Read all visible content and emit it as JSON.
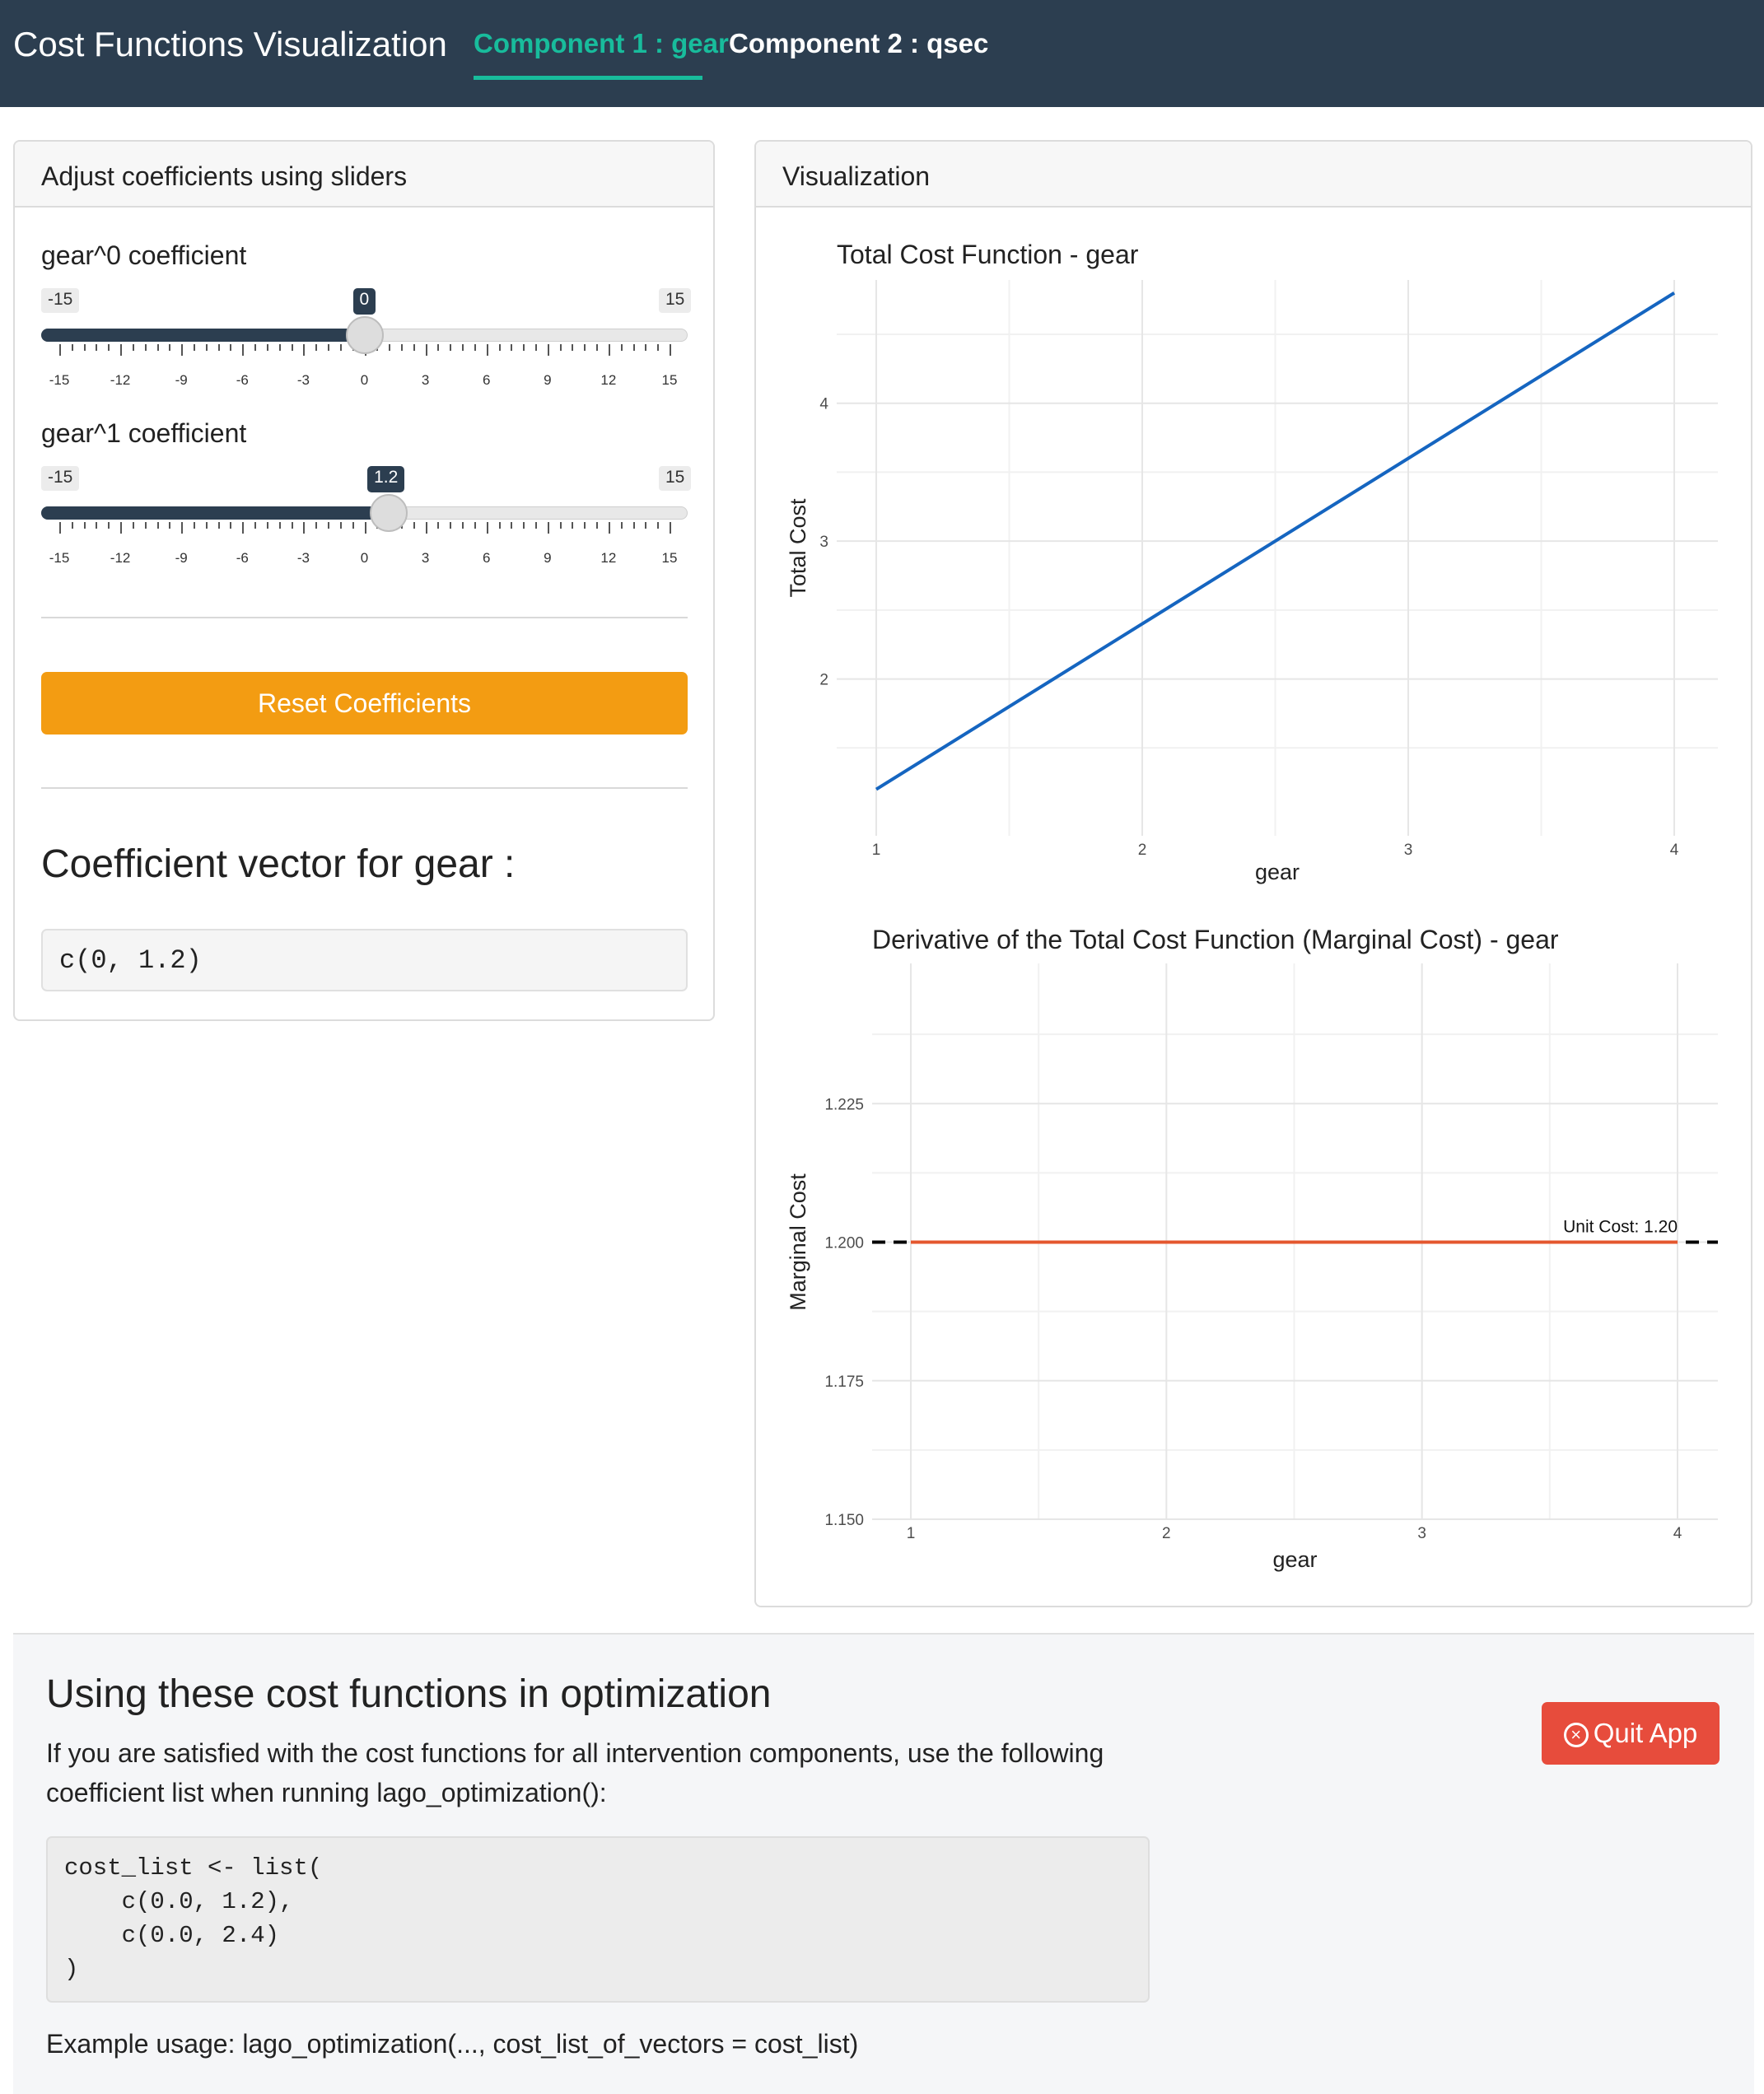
{
  "navbar": {
    "title": "Cost Functions Visualization",
    "tabs": [
      {
        "label": "Component 1 : gear",
        "active": true
      },
      {
        "label": "Component 2 : qsec",
        "active": false
      }
    ]
  },
  "sidebar": {
    "header": "Adjust coefficients using sliders",
    "sliders": [
      {
        "label": "gear^0 coefficient",
        "min": "-15",
        "max": "15",
        "value": "0",
        "value_num": 0
      },
      {
        "label": "gear^1 coefficient",
        "min": "-15",
        "max": "15",
        "value": "1.2",
        "value_num": 1.2
      }
    ],
    "tick_labels": [
      "-15",
      "-12",
      "-9",
      "-6",
      "-3",
      "0",
      "3",
      "6",
      "9",
      "12",
      "15"
    ],
    "reset_label": "Reset Coefficients",
    "coef_title": "Coefficient vector for gear :",
    "coef_code": "c(0, 1.2)"
  },
  "viz": {
    "header": "Visualization"
  },
  "chart_data": [
    {
      "type": "line",
      "title": "Total Cost Function - gear",
      "xlabel": "gear",
      "ylabel": "Total Cost",
      "x": [
        1,
        4
      ],
      "y": [
        1.2,
        4.8
      ],
      "xlim": [
        1,
        4
      ],
      "ylim": [
        1.0,
        4.9
      ],
      "xticks": [
        "1",
        "2",
        "3",
        "4"
      ],
      "yticks": [
        "2",
        "3",
        "4"
      ],
      "ytick_values": [
        2,
        3,
        4
      ],
      "color": "#1565c0",
      "grid": true
    },
    {
      "type": "line",
      "title": "Derivative of the Total Cost Function (Marginal Cost) - gear",
      "xlabel": "gear",
      "ylabel": "Marginal Cost",
      "x": [
        1,
        4
      ],
      "y": [
        1.2,
        1.2
      ],
      "xlim": [
        1,
        4
      ],
      "ylim": [
        1.15,
        1.25
      ],
      "xticks": [
        "1",
        "2",
        "3",
        "4"
      ],
      "yticks": [
        "1.150",
        "1.175",
        "1.200",
        "1.225"
      ],
      "ytick_values": [
        1.15,
        1.175,
        1.2,
        1.225
      ],
      "color": "#e4572e",
      "reference_line": {
        "y": 1.2,
        "style": "dashed",
        "color": "#000000"
      },
      "annotation": "Unit Cost: 1.20",
      "grid": true
    }
  ],
  "optimization": {
    "title": "Using these cost functions in optimization",
    "text": "If you are satisfied with the cost functions for all intervention components, use the following coefficient list when running lago_optimization():",
    "code": "cost_list <- list(\n    c(0.0, 1.2),\n    c(0.0, 2.4)\n)",
    "example": "Example usage: lago_optimization(..., cost_list_of_vectors = cost_list)",
    "quit_label": "Quit App",
    "quit_icon": "times-circle-icon"
  }
}
